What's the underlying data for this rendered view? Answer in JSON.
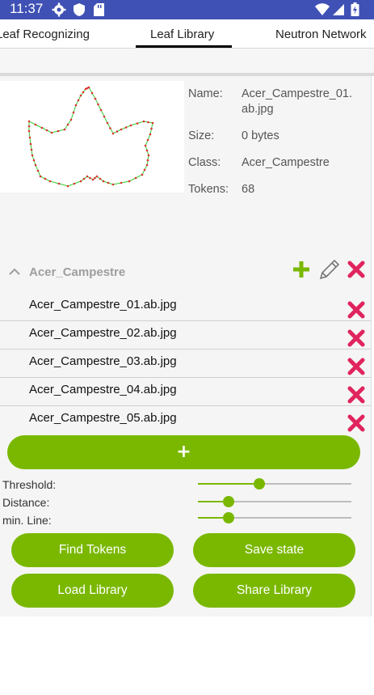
{
  "status_bar": {
    "time": "11:37",
    "left_icons": [
      "gear-icon",
      "shield-icon",
      "sd-card-icon"
    ],
    "right_icons": [
      "wifi-icon",
      "signal-icon",
      "battery-charging-icon"
    ]
  },
  "tabs": [
    {
      "label": "Leaf Recognizing",
      "selected": false
    },
    {
      "label": "Leaf Library",
      "selected": true
    },
    {
      "label": "Neutron Network",
      "selected": false
    }
  ],
  "details": {
    "name_label": "Name:",
    "name_value_line1": "Acer_Campestre_01.",
    "name_value_line2": "ab.jpg",
    "size_label": "Size:",
    "size_value": "0 bytes",
    "class_label": "Class:",
    "class_value": "Acer_Campestre",
    "tokens_label": "Tokens:",
    "tokens_value": "68"
  },
  "group": {
    "title": "Acer_Campestre",
    "expanded": true,
    "actions": [
      "plus-icon",
      "pencil-icon",
      "close-icon"
    ],
    "items": [
      {
        "label": "Acer_Campestre_01.ab.jpg"
      },
      {
        "label": "Acer_Campestre_02.ab.jpg"
      },
      {
        "label": "Acer_Campestre_03.ab.jpg"
      },
      {
        "label": "Acer_Campestre_04.ab.jpg"
      },
      {
        "label": "Acer_Campestre_05.ab.jpg"
      }
    ]
  },
  "add_button_label": "+",
  "sliders": [
    {
      "label": "Threshold:",
      "value": 0.4
    },
    {
      "label": "Distance:",
      "value": 0.2
    },
    {
      "label": "min. Line:",
      "value": 0.2
    }
  ],
  "buttons": {
    "find_tokens": "Find Tokens",
    "save_state": "Save state",
    "load_library": "Load Library",
    "share_library": "Share Library"
  },
  "colors": {
    "accent": "#7ab800",
    "status_bar": "#3f51b5",
    "delete": "#e0245e",
    "outline_stroke": "#33cc33",
    "token_dot": "#e03030"
  }
}
